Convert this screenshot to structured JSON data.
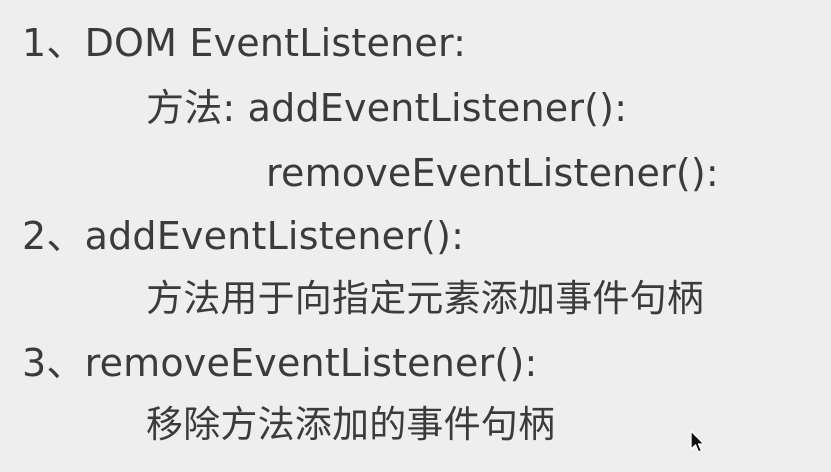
{
  "lines": {
    "l1": "1、DOM EventListener:",
    "l2": "方法: addEventListener():",
    "l3": "removeEventListener():",
    "l4": "2、addEventListener():",
    "l5": "方法用于向指定元素添加事件句柄",
    "l6": "3、removeEventListener():",
    "l7": "移除方法添加的事件句柄"
  },
  "icons": {
    "cursor": "mouse-pointer-icon"
  },
  "colors": {
    "background": "#eeeeee",
    "text": "#3b3b3b"
  }
}
